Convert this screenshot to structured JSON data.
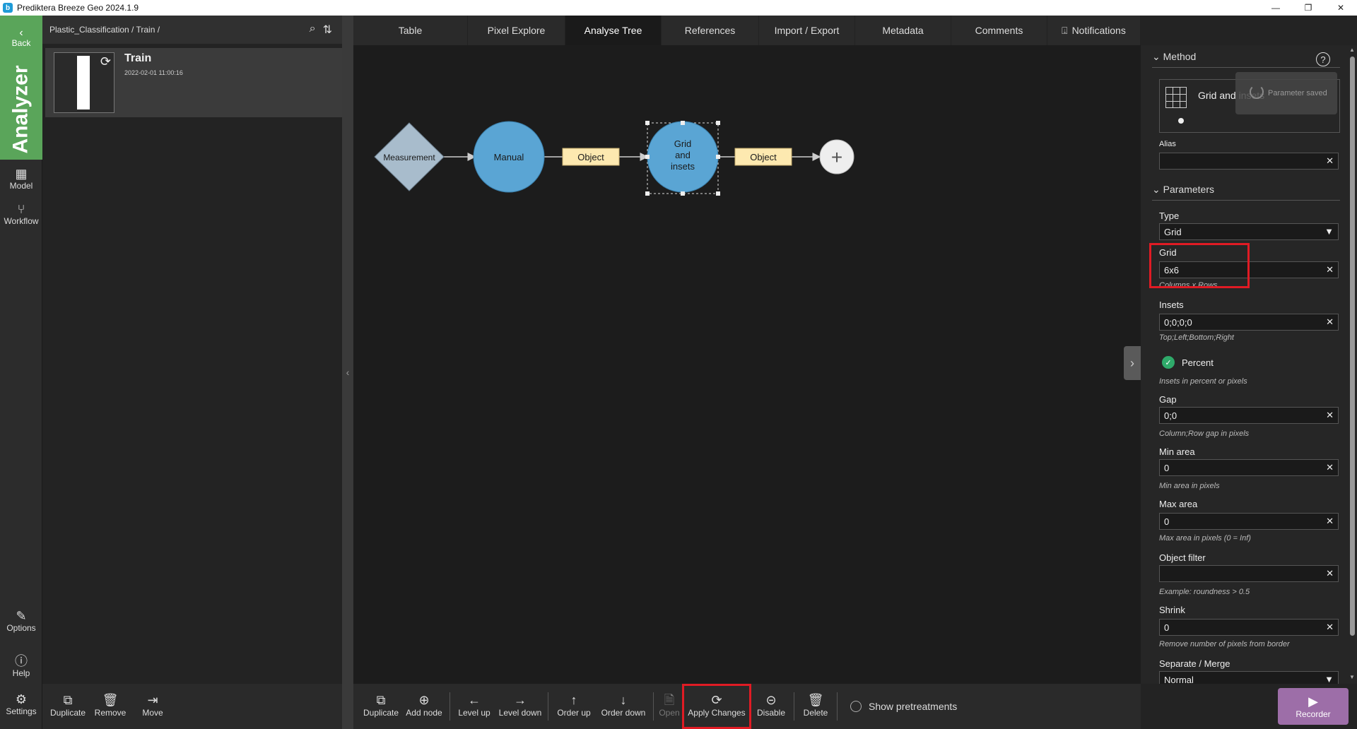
{
  "window": {
    "title": "Prediktera Breeze Geo 2024.1.9",
    "logo": "b",
    "minimize": "—",
    "maximize": "❐",
    "close": "✕"
  },
  "leftnav": {
    "back": "Back",
    "app": "Analyzer",
    "model": "Model",
    "workflow": "Workflow",
    "options": "Options",
    "help": "Help",
    "settings": "Settings"
  },
  "tree": {
    "breadcrumb": "Plastic_Classification / Train /",
    "item": {
      "name": "Train",
      "date": "2022-02-01 11:00:16"
    },
    "tools": {
      "duplicate": "Duplicate",
      "remove": "Remove",
      "move": "Move"
    }
  },
  "tabs": [
    "Table",
    "Pixel Explore",
    "Analyse Tree",
    "References",
    "Import / Export",
    "Metadata",
    "Comments",
    "Notifications"
  ],
  "active_tab": "Analyse Tree",
  "diagram": {
    "measurement": "Measurement",
    "manual": "Manual",
    "object1": "Object",
    "grid_line1": "Grid",
    "grid_line2": "and",
    "grid_line3": "insets",
    "object2": "Object",
    "add": "+"
  },
  "bottombar": {
    "duplicate": "Duplicate",
    "add_node": "Add node",
    "level_up": "Level up",
    "level_down": "Level down",
    "order_up": "Order up",
    "order_down": "Order down",
    "open": "Open",
    "apply_changes": "Apply Changes",
    "disable": "Disable",
    "delete": "Delete",
    "show_pretreatments": "Show pretreatments"
  },
  "panel": {
    "method_header": "Method",
    "method_name": "Grid and insets",
    "toast": "Parameter saved",
    "alias_label": "Alias",
    "alias_value": "",
    "parameters_header": "Parameters",
    "type_label": "Type",
    "type_value": "Grid",
    "grid_label": "Grid",
    "grid_value": "6x6",
    "grid_hint": "Columns x Rows",
    "insets_label": "Insets",
    "insets_value": "0;0;0;0",
    "insets_hint": "Top;Left;Bottom;Right",
    "percent_label": "Percent",
    "percent_hint": "Insets in percent or pixels",
    "gap_label": "Gap",
    "gap_value": "0;0",
    "gap_hint": "Column;Row gap in pixels",
    "minarea_label": "Min area",
    "minarea_value": "0",
    "minarea_hint": "Min area in pixels",
    "maxarea_label": "Max area",
    "maxarea_value": "0",
    "maxarea_hint": "Max area in pixels (0 = Inf)",
    "objfilter_label": "Object filter",
    "objfilter_value": "",
    "objfilter_hint": "Example: roundness > 0.5",
    "shrink_label": "Shrink",
    "shrink_value": "0",
    "shrink_hint": "Remove number of pixels from border",
    "sepmerge_label": "Separate / Merge",
    "sepmerge_value": "Normal"
  },
  "recorder": "Recorder",
  "colors": {
    "accent_green": "#5aa55a",
    "node_blue": "#5aa5d4",
    "object_yellow": "#fde9b0",
    "highlight_red": "#e01b24",
    "recorder_purple": "#9d6ea8"
  }
}
